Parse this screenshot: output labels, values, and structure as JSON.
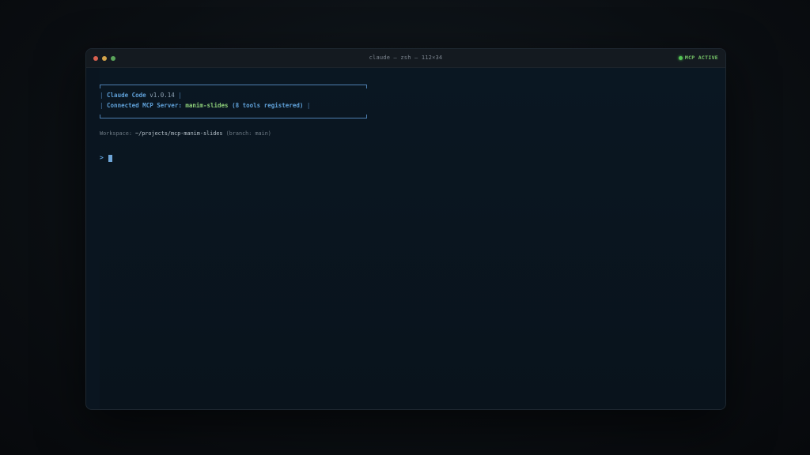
{
  "window": {
    "title": "claude — zsh — 112×34",
    "traffic_lights": [
      "close",
      "minimize",
      "maximize"
    ],
    "status": {
      "label": "MCP ACTIVE",
      "color": "#54c354"
    }
  },
  "terminal": {
    "banner": {
      "pipe": "|",
      "app_name": "Claude Code",
      "version": "v1.0.14",
      "connected_label": "Connected MCP Server:",
      "server_name": "manim-slides",
      "tools_text": "(8 tools registered)"
    },
    "workspace": {
      "label": "Workspace:",
      "path": "~/projects/mcp-manim-slides",
      "branch": "(branch: main)"
    },
    "prompt": {
      "symbol": ">"
    }
  },
  "colors": {
    "accent_blue": "#5fa0d8",
    "accent_green": "#8ed07a",
    "background": "#0a1520"
  }
}
